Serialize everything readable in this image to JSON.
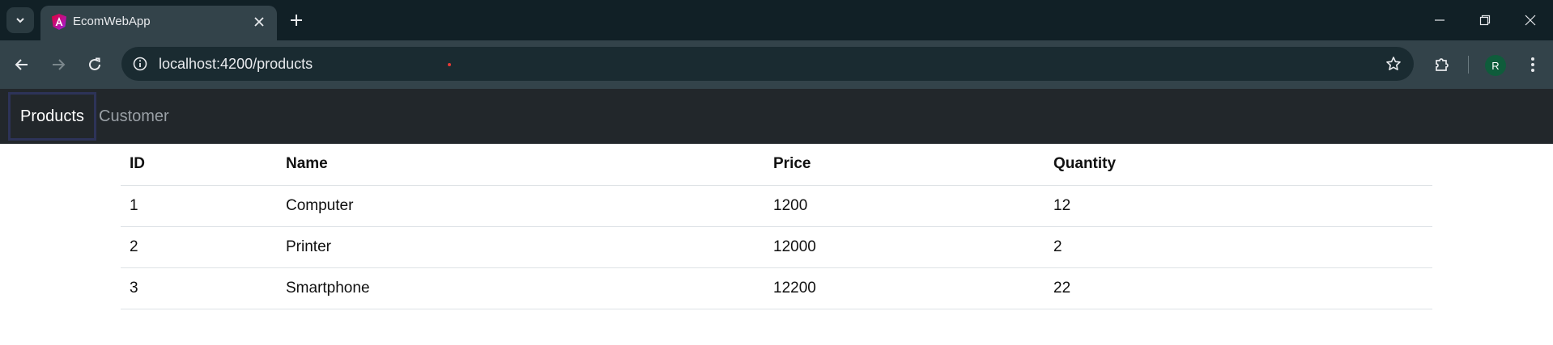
{
  "browser": {
    "tab": {
      "title": "EcomWebApp",
      "favicon": "angular-icon"
    },
    "address_bar": {
      "url": "localhost:4200/products"
    },
    "profile_initial": "R"
  },
  "app": {
    "nav": [
      {
        "label": "Products",
        "active": true
      },
      {
        "label": "Customer",
        "active": false
      }
    ]
  },
  "products_table": {
    "headers": [
      "ID",
      "Name",
      "Price",
      "Quantity"
    ],
    "rows": [
      [
        "1",
        "Computer",
        "1200",
        "12"
      ],
      [
        "2",
        "Printer",
        "12000",
        "2"
      ],
      [
        "3",
        "Smartphone",
        "12200",
        "22"
      ]
    ]
  },
  "colors": {
    "tabstrip_bg": "#112026",
    "toolbar_bg": "#33434a",
    "appnav_bg": "#22272b",
    "active_nav_border": "#2d3358"
  }
}
